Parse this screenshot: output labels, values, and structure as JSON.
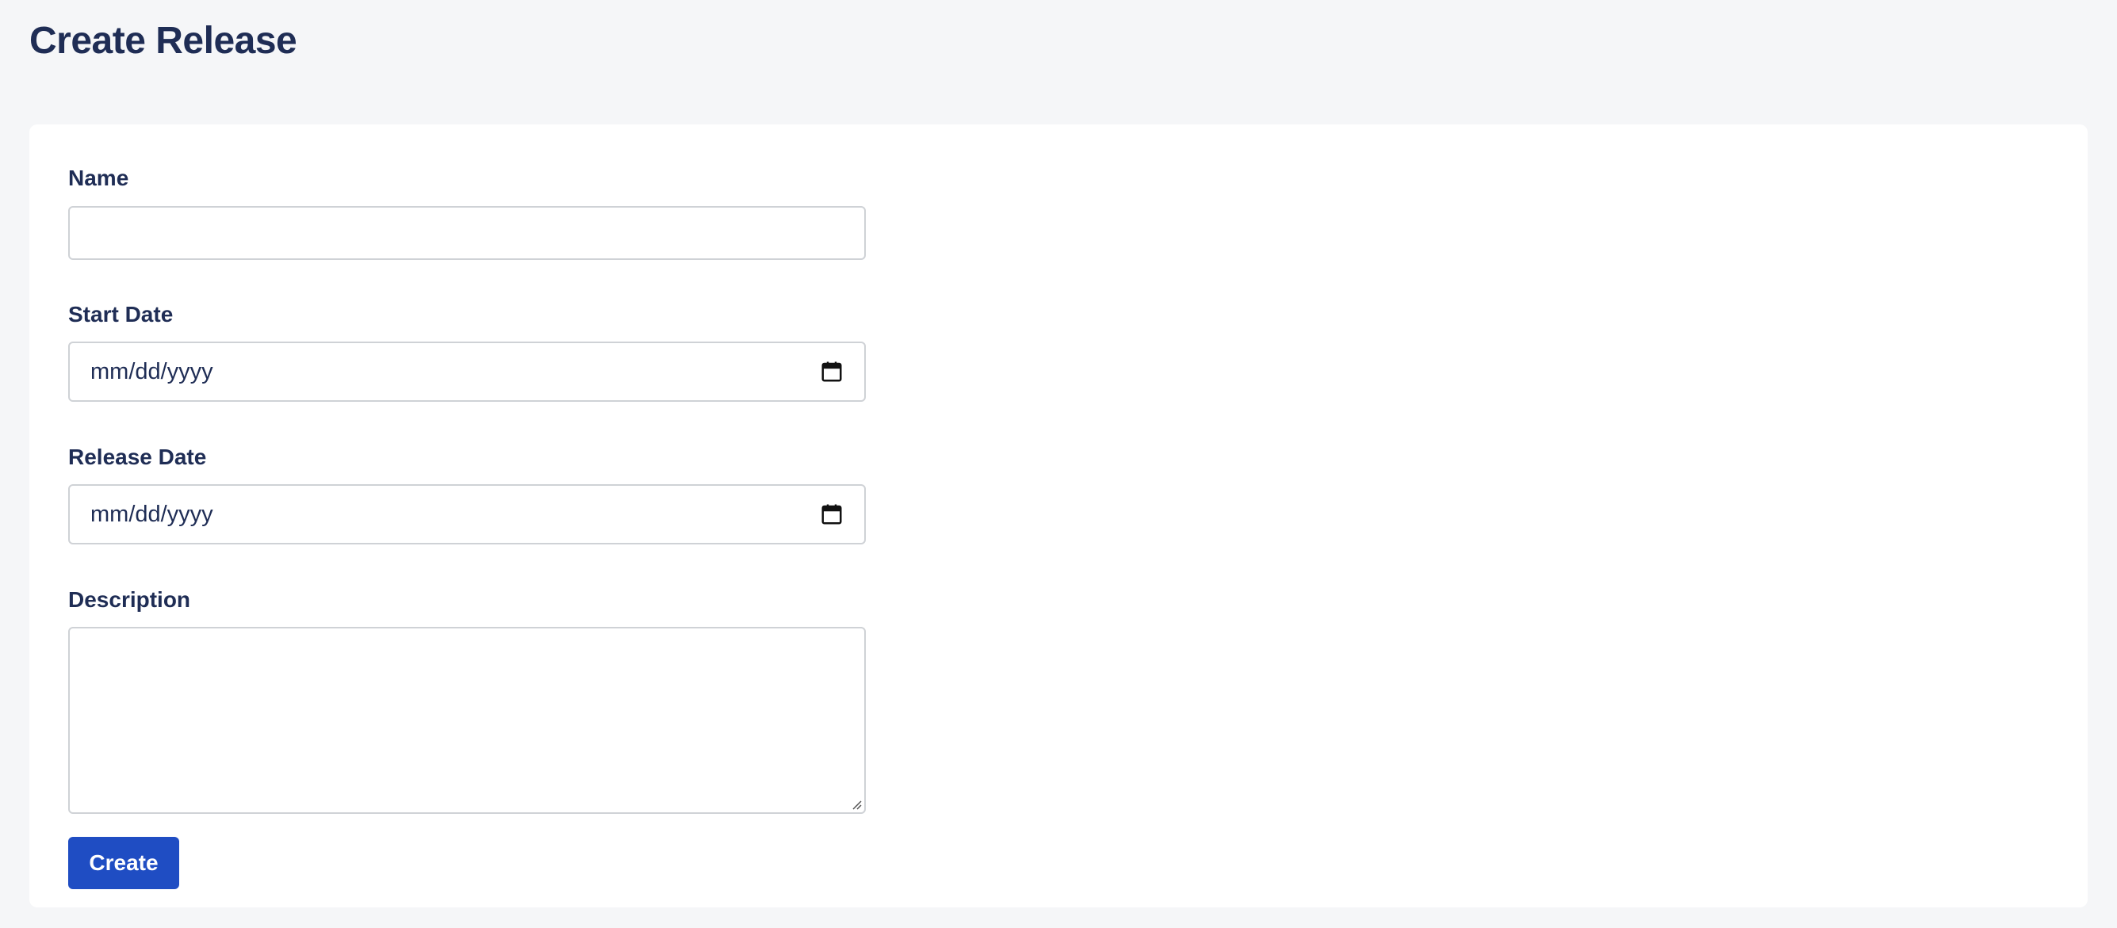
{
  "page": {
    "title": "Create Release"
  },
  "form": {
    "name": {
      "label": "Name",
      "value": "",
      "placeholder": ""
    },
    "start_date": {
      "label": "Start Date",
      "placeholder": "mm/dd/yyyy",
      "icon": "calendar-icon"
    },
    "release_date": {
      "label": "Release Date",
      "placeholder": "mm/dd/yyyy",
      "icon": "calendar-icon"
    },
    "description": {
      "label": "Description",
      "value": ""
    },
    "submit_label": "Create"
  },
  "colors": {
    "background": "#f5f6f8",
    "card": "#ffffff",
    "text": "#1f2d55",
    "button": "#1f4dc3",
    "border": "#cfd2d6"
  }
}
